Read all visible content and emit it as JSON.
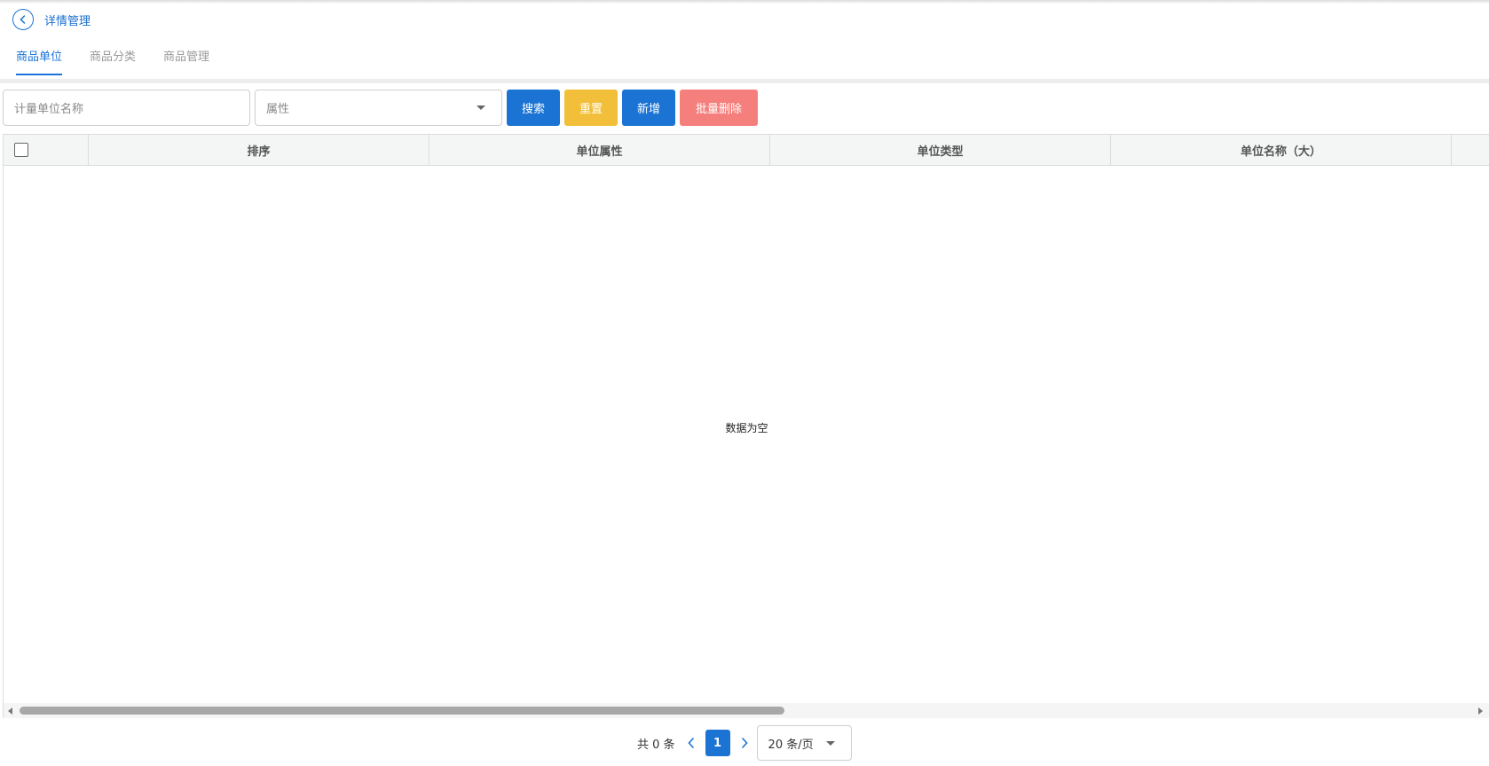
{
  "header": {
    "title": "详情管理",
    "back_icon": "chevron-left-circle-icon"
  },
  "tabs": [
    {
      "label": "商品单位",
      "active": true
    },
    {
      "label": "商品分类",
      "active": false
    },
    {
      "label": "商品管理",
      "active": false
    }
  ],
  "toolbar": {
    "name_placeholder": "计量单位名称",
    "attribute_placeholder": "属性",
    "search_label": "搜索",
    "reset_label": "重置",
    "add_label": "新增",
    "batch_delete_label": "批量删除"
  },
  "table": {
    "columns": [
      "排序",
      "单位属性",
      "单位类型",
      "单位名称（大）"
    ],
    "rows": [],
    "empty_text": "数据为空"
  },
  "pagination": {
    "total_text": "共 0 条",
    "current_page": "1",
    "page_size": "20 条/页"
  },
  "colors": {
    "primary": "#1b74d4",
    "warning": "#f2bf3a",
    "danger_light": "#f57f7c"
  }
}
